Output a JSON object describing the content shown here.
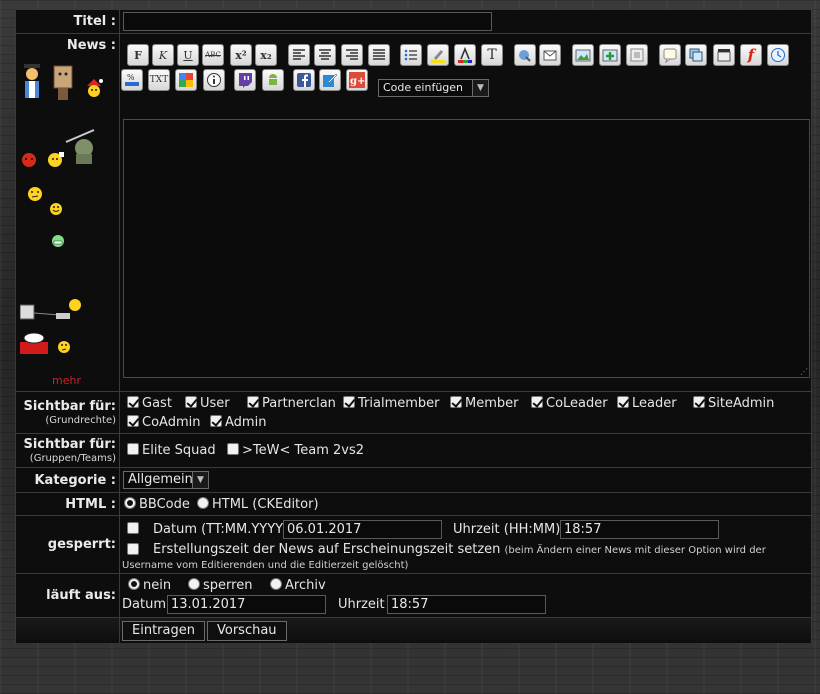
{
  "labels": {
    "title": "Titel :",
    "news": "News :",
    "more": "mehr",
    "visible_basic": "Sichtbar für:",
    "visible_basic_sub": "(Grundrechte)",
    "visible_groups": "Sichtbar für:",
    "visible_groups_sub": "(Gruppen/Teams)",
    "category": "Kategorie :",
    "html": "HTML :",
    "locked": "gesperrt:",
    "expires": "läuft aus:"
  },
  "title_value": "",
  "toolbar": {
    "code_select": "Code einfügen",
    "buttons": [
      "bold",
      "italic",
      "underline",
      "strikethrough",
      "superscript",
      "subscript",
      "align-left",
      "align-center",
      "align-right",
      "justify",
      "list",
      "highlight",
      "font-color",
      "font-size",
      "link",
      "email",
      "image",
      "image-add",
      "image-frame",
      "quote",
      "spoiler",
      "video",
      "flash",
      "clock",
      "percent",
      "txt",
      "google",
      "info",
      "twitch",
      "android",
      "facebook",
      "edit",
      "google-plus"
    ]
  },
  "basic_rights": [
    {
      "label": "Gast",
      "checked": true
    },
    {
      "label": "User",
      "checked": true
    },
    {
      "label": "Partnerclan",
      "checked": true
    },
    {
      "label": "Trialmember",
      "checked": true
    },
    {
      "label": "Member",
      "checked": true
    },
    {
      "label": "CoLeader",
      "checked": true
    },
    {
      "label": "Leader",
      "checked": true
    },
    {
      "label": "SiteAdmin",
      "checked": true
    },
    {
      "label": "CoAdmin",
      "checked": true
    },
    {
      "label": "Admin",
      "checked": true
    }
  ],
  "groups": [
    {
      "label": "Elite Squad",
      "checked": false
    },
    {
      "label": ">TeW< Team 2vs2",
      "checked": false
    }
  ],
  "category_value": "Allgemein",
  "html_mode": {
    "bbcode": "BBCode",
    "ckeditor": "HTML (CKEditor)",
    "selected": "bbcode"
  },
  "locked": {
    "date_label": "Datum (TT:MM.YYYY)",
    "date_value": "06.01.2017",
    "time_label": "Uhrzeit (HH:MM)",
    "time_value": "18:57",
    "created_label": "Erstellungszeit der News auf Erscheinungszeit setzen",
    "created_note": "(beim Ändern einer News mit dieser Option wird der Username vom Editierenden und die Editierzeit gelöscht)"
  },
  "expires": {
    "option_none": "nein",
    "option_lock": "sperren",
    "option_archive": "Archiv",
    "selected": "none",
    "date_label": "Datum",
    "date_value": "13.01.2017",
    "time_label": "Uhrzeit",
    "time_value": "18:57"
  },
  "actions": {
    "submit": "Eintragen",
    "preview": "Vorschau"
  },
  "colors": {
    "panel": "#0d0d0d",
    "border": "#3a3a3a",
    "more_link": "#cc2222"
  }
}
